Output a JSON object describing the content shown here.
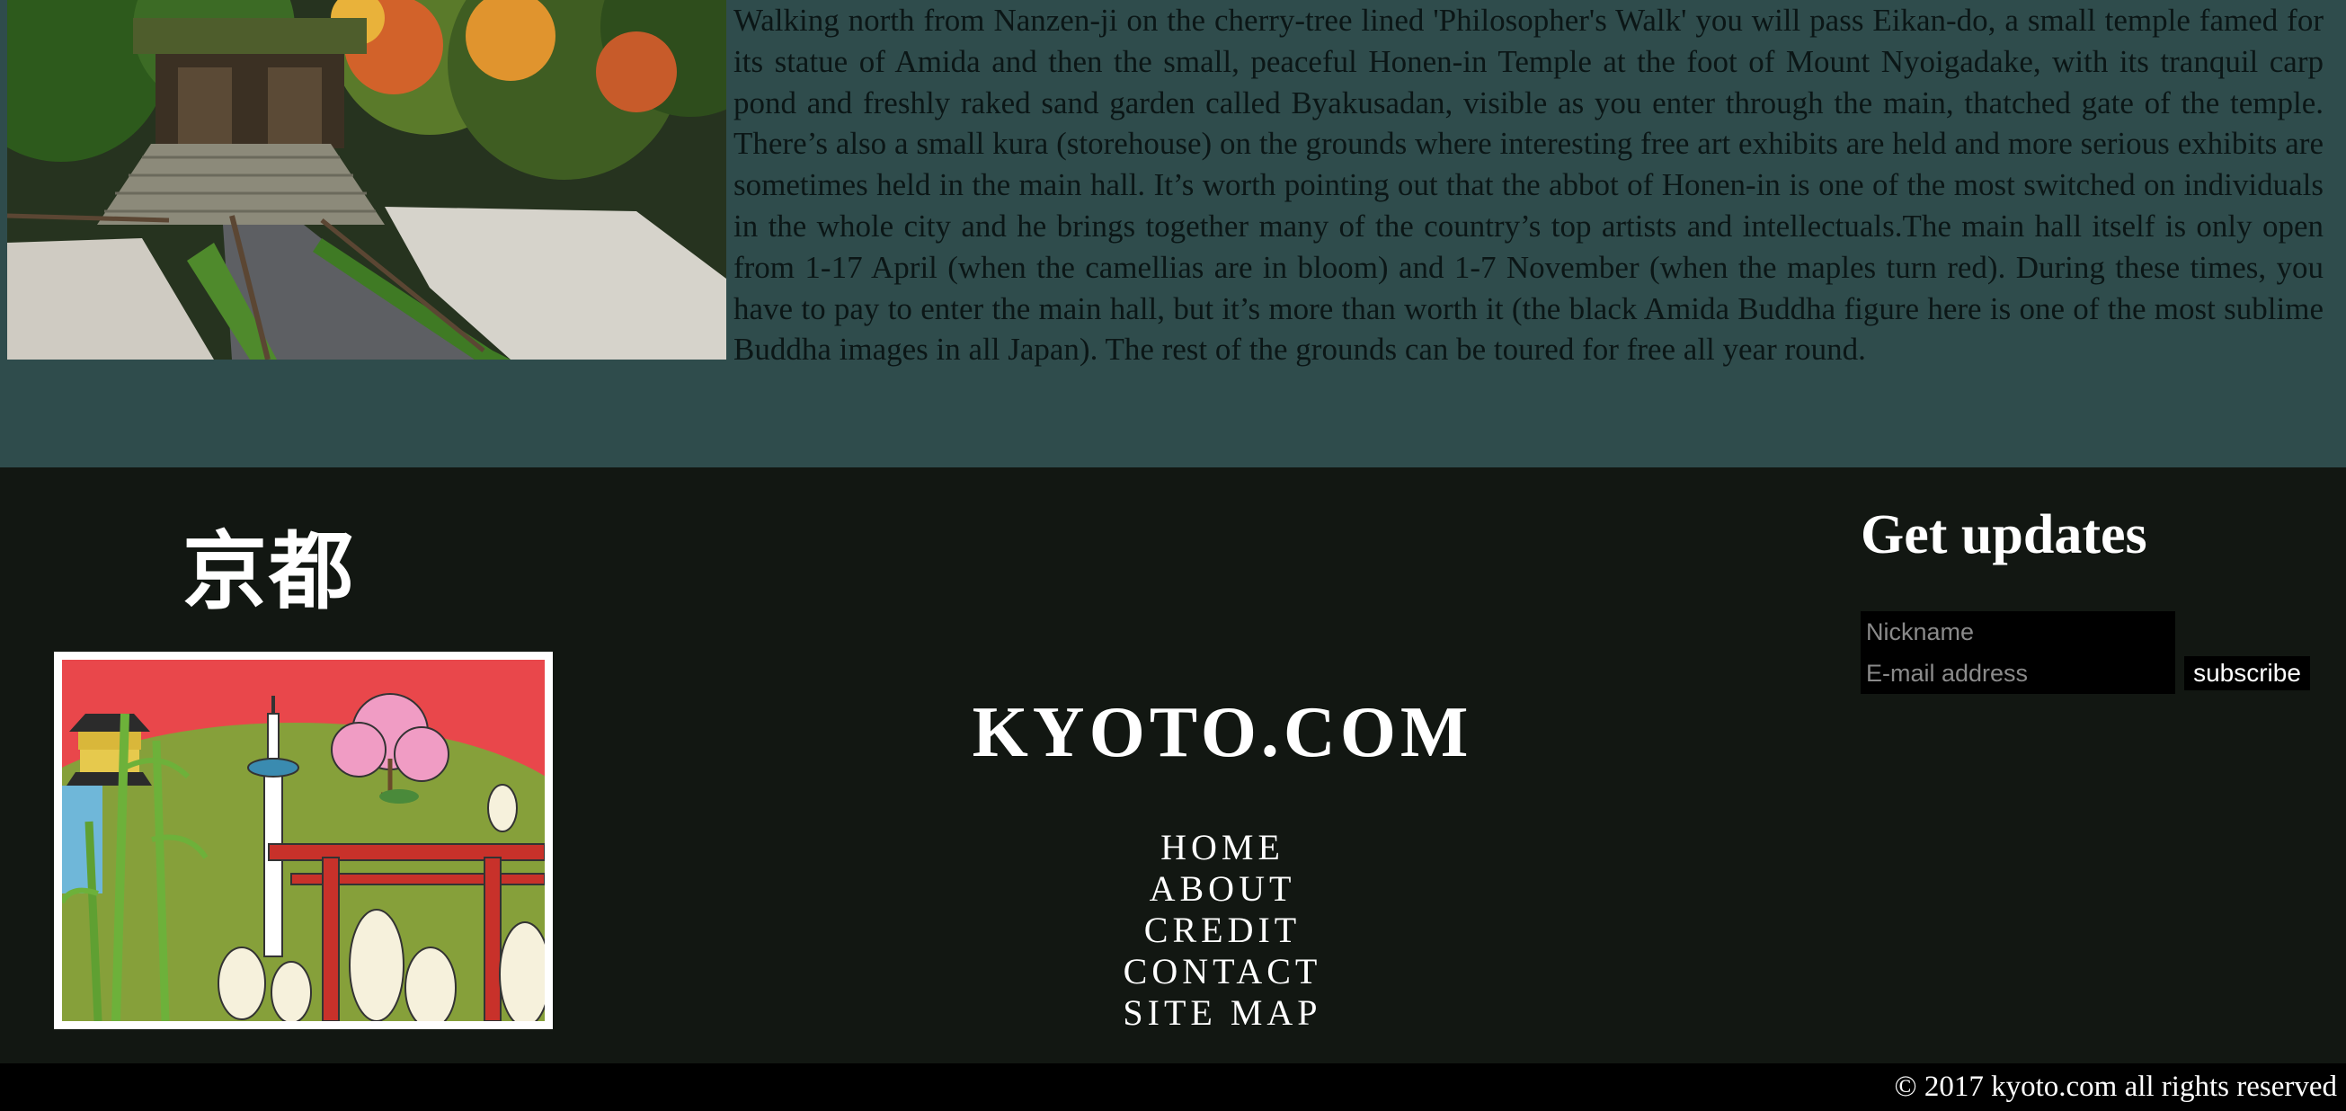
{
  "article": {
    "text": "Walking north from Nanzen-ji on the cherry-tree lined 'Philosopher's Walk' you will pass Eikan-do, a small temple famed for its statue of Amida and then the small, peaceful Honen-in Temple at the foot of Mount Nyoigadake, with its tranquil carp pond and freshly raked sand garden called Byakusadan, visible as you enter through the main, thatched gate of the temple. There’s also a small kura (storehouse) on the grounds where interesting free art exhibits are held and more serious exhibits are sometimes held in the main hall. It’s worth pointing out that the abbot of Honen-in is one of the most switched on individuals in the whole city and he brings together many of the country’s top artists and intellectuals.The main hall itself is only open from 1-17 April (when the camellias are in bloom) and 1-7 November (when the maples turn red). During these times, you have to pay to enter the main hall, but it’s more than worth it (the black Amida Buddha figure here is one of the most sublime Buddha images in all Japan). The rest of the grounds can be toured for free all year round."
  },
  "footer": {
    "brand_jp": "京都",
    "site_title": "KYOTO.COM",
    "nav": [
      "HOME",
      "ABOUT",
      "CREDIT",
      "CONTACT",
      "SITE MAP"
    ],
    "updates": {
      "title": "Get updates",
      "nickname_placeholder": "Nickname",
      "email_placeholder": "E-mail address",
      "subscribe_label": "subscribe"
    },
    "copyright": "© 2017 kyoto.com all rights reserved"
  },
  "colors": {
    "article_bg": "#2f4c4c",
    "footer_bg": "#121712",
    "copyright_bg": "#000000",
    "text_light": "#ffffff"
  }
}
